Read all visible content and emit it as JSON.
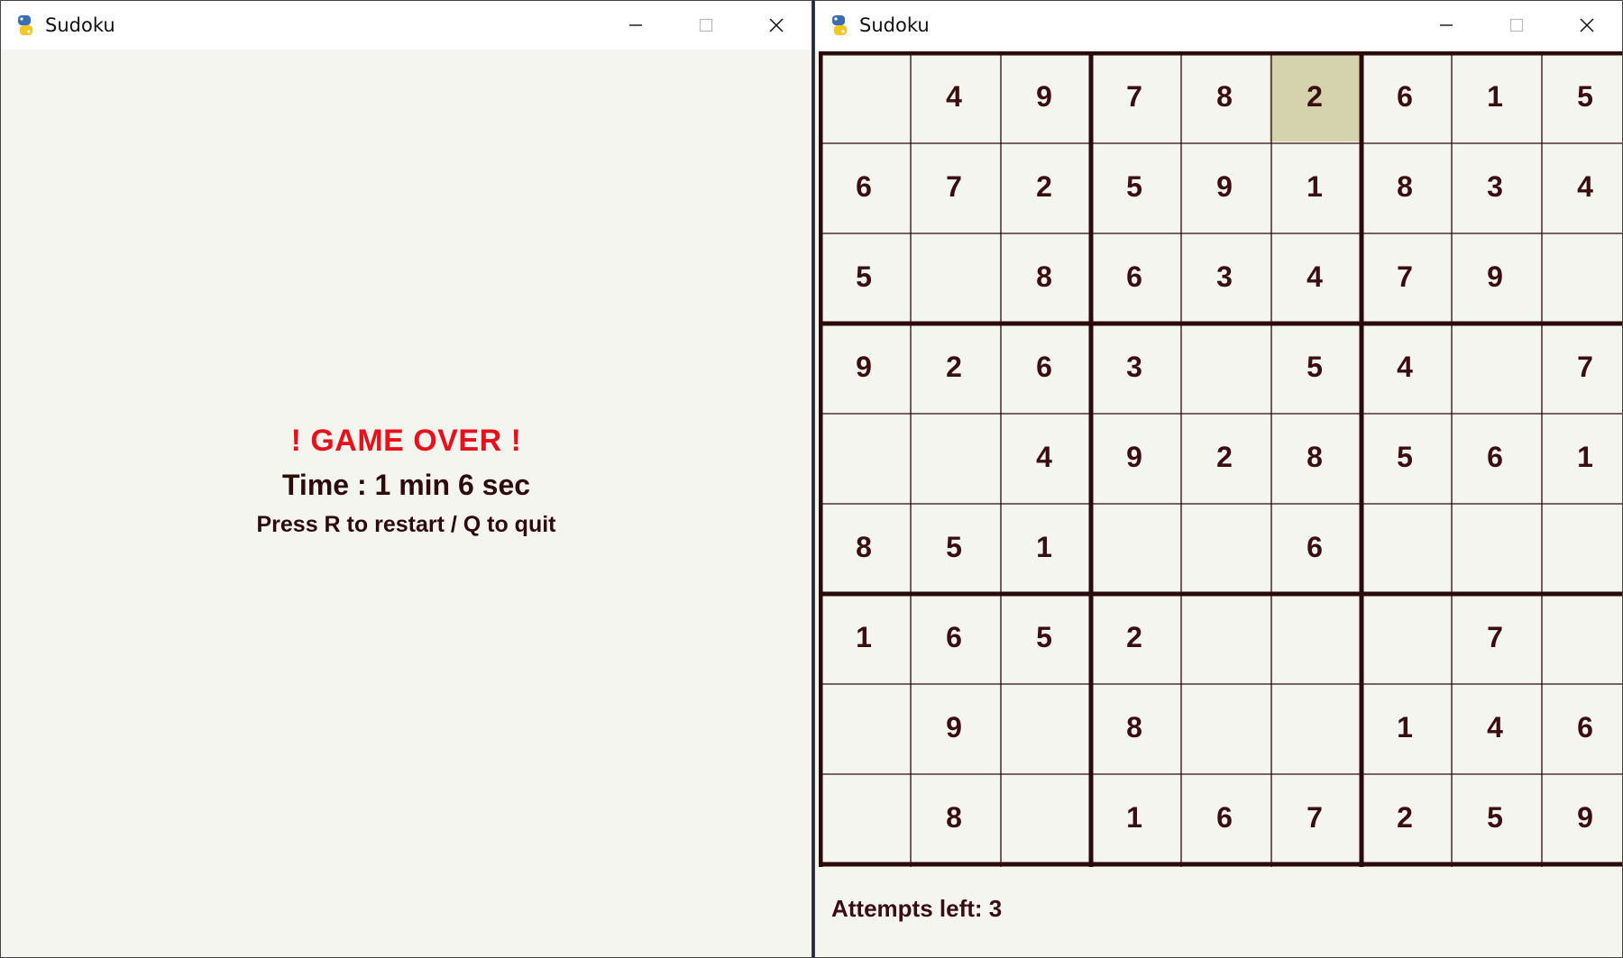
{
  "windows": [
    {
      "title": "Sudoku",
      "screen": "game-over",
      "game_over": {
        "title": "! GAME OVER !",
        "time": "Time : 1 min 6 sec",
        "instructions": "Press R to restart / Q to quit"
      }
    },
    {
      "title": "Sudoku",
      "screen": "board",
      "selected_cell": [
        0,
        5
      ],
      "grid": [
        [
          "",
          "4",
          "9",
          "7",
          "8",
          "2",
          "6",
          "1",
          "5"
        ],
        [
          "6",
          "7",
          "2",
          "5",
          "9",
          "1",
          "8",
          "3",
          "4"
        ],
        [
          "5",
          "",
          "8",
          "6",
          "3",
          "4",
          "7",
          "9",
          ""
        ],
        [
          "9",
          "2",
          "6",
          "3",
          "",
          "5",
          "4",
          "",
          "7"
        ],
        [
          "",
          "",
          "4",
          "9",
          "2",
          "8",
          "5",
          "6",
          "1"
        ],
        [
          "8",
          "5",
          "1",
          "",
          "",
          "6",
          "",
          "",
          ""
        ],
        [
          "1",
          "6",
          "5",
          "2",
          "",
          "",
          "",
          "7",
          ""
        ],
        [
          "",
          "9",
          "",
          "8",
          "",
          "",
          "1",
          "4",
          "6"
        ],
        [
          "",
          "8",
          "",
          "1",
          "6",
          "7",
          "2",
          "5",
          "9"
        ]
      ],
      "attempts_label": "Attempts left: 3"
    }
  ],
  "colors": {
    "background": "#f5f5f0",
    "digit": "#3b0d10",
    "game_over_title": "#e8101a",
    "selected_cell": "#d4d3ae",
    "grid_line": "#2a0a0a"
  },
  "icons": {
    "app": "python-snake-icon",
    "minimize": "minimize-icon",
    "maximize": "maximize-icon",
    "close": "close-icon"
  }
}
